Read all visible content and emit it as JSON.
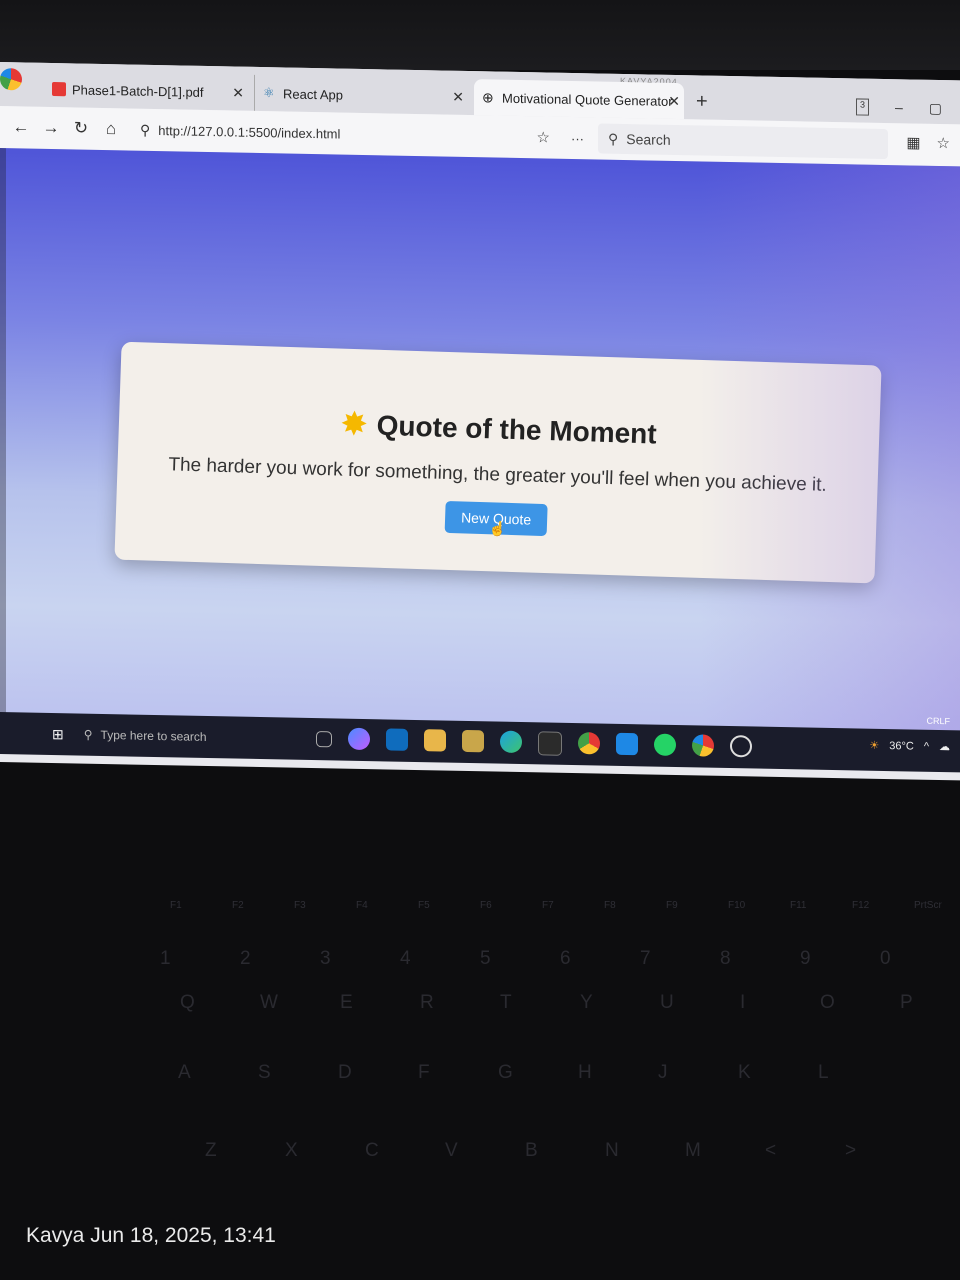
{
  "browser": {
    "tabs": [
      {
        "label": "Phase1-Batch-D[1].pdf",
        "icon": "pdf-icon"
      },
      {
        "label": "React App",
        "icon": "react-icon"
      },
      {
        "label": "Motivational Quote Generator",
        "icon": "globe-icon"
      }
    ],
    "profile_name": "KAVYA2004",
    "tab_count": "3",
    "url": "http://127.0.0.1:5500/index.html",
    "search_placeholder": "Search"
  },
  "page": {
    "heading": "Quote of the Moment",
    "quote": "The harder you work for something, the greater you'll feel when you achieve it.",
    "button_label": "New Quote",
    "colors": {
      "button": "#3d95e6",
      "card": "#f3efea",
      "background_top": "#4f55d8"
    }
  },
  "taskbar": {
    "search_placeholder": "Type here to search",
    "temperature": "36°C",
    "line_ending": "CRLF"
  },
  "keyboard": {
    "function_keys": [
      "F1",
      "F2",
      "F3",
      "F4",
      "F5",
      "F6",
      "F7",
      "F8",
      "F9",
      "F10",
      "F11",
      "F12",
      "PrtScr"
    ],
    "number_row": [
      "1",
      "2",
      "3",
      "4",
      "5",
      "6",
      "7",
      "8",
      "9",
      "0"
    ],
    "top_row": [
      "Q",
      "W",
      "E",
      "R",
      "T",
      "Y",
      "U",
      "I",
      "O",
      "P"
    ],
    "home_row": [
      "A",
      "S",
      "D",
      "F",
      "G",
      "H",
      "J",
      "K",
      "L"
    ],
    "bottom_row": [
      "Z",
      "X",
      "C",
      "V",
      "B",
      "N",
      "M",
      "<",
      ">"
    ]
  },
  "photo_stamp": "Kavya  Jun 18, 2025, 13:41"
}
